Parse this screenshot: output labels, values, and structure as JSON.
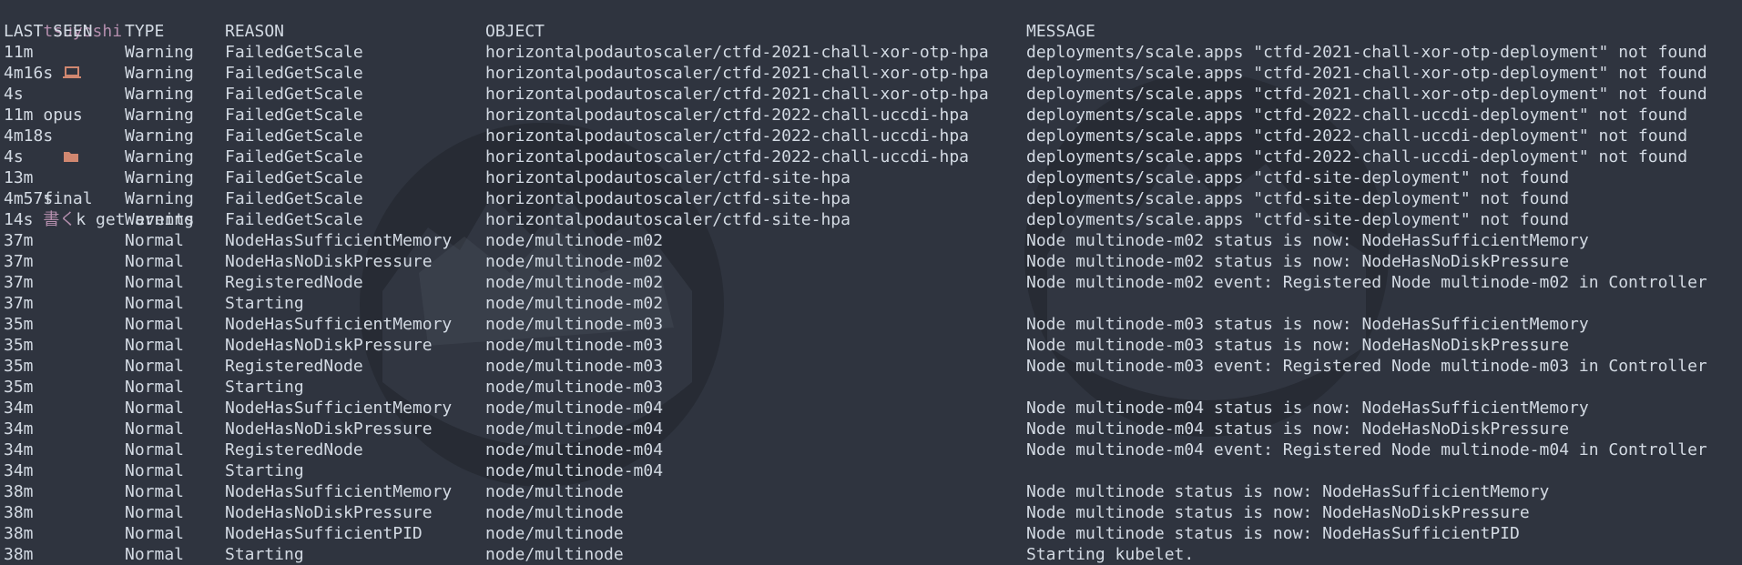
{
  "prompt": {
    "user": "tsuyoshi",
    "host_icon": "laptop-icon",
    "host": "opus",
    "folder_icon": "folder-icon",
    "dir": "final",
    "glyph": "書く",
    "command": "k get events"
  },
  "headers": {
    "last_seen": "LAST SEEN",
    "type": "TYPE",
    "reason": "REASON",
    "object": "OBJECT",
    "message": "MESSAGE"
  },
  "rows": [
    {
      "last_seen": "11m",
      "type": "Warning",
      "reason": "FailedGetScale",
      "object": "horizontalpodautoscaler/ctfd-2021-chall-xor-otp-hpa",
      "message": "deployments/scale.apps \"ctfd-2021-chall-xor-otp-deployment\" not found"
    },
    {
      "last_seen": "4m16s",
      "type": "Warning",
      "reason": "FailedGetScale",
      "object": "horizontalpodautoscaler/ctfd-2021-chall-xor-otp-hpa",
      "message": "deployments/scale.apps \"ctfd-2021-chall-xor-otp-deployment\" not found"
    },
    {
      "last_seen": "4s",
      "type": "Warning",
      "reason": "FailedGetScale",
      "object": "horizontalpodautoscaler/ctfd-2021-chall-xor-otp-hpa",
      "message": "deployments/scale.apps \"ctfd-2021-chall-xor-otp-deployment\" not found"
    },
    {
      "last_seen": "11m",
      "type": "Warning",
      "reason": "FailedGetScale",
      "object": "horizontalpodautoscaler/ctfd-2022-chall-uccdi-hpa",
      "message": "deployments/scale.apps \"ctfd-2022-chall-uccdi-deployment\" not found"
    },
    {
      "last_seen": "4m18s",
      "type": "Warning",
      "reason": "FailedGetScale",
      "object": "horizontalpodautoscaler/ctfd-2022-chall-uccdi-hpa",
      "message": "deployments/scale.apps \"ctfd-2022-chall-uccdi-deployment\" not found"
    },
    {
      "last_seen": "4s",
      "type": "Warning",
      "reason": "FailedGetScale",
      "object": "horizontalpodautoscaler/ctfd-2022-chall-uccdi-hpa",
      "message": "deployments/scale.apps \"ctfd-2022-chall-uccdi-deployment\" not found"
    },
    {
      "last_seen": "13m",
      "type": "Warning",
      "reason": "FailedGetScale",
      "object": "horizontalpodautoscaler/ctfd-site-hpa",
      "message": "deployments/scale.apps \"ctfd-site-deployment\" not found"
    },
    {
      "last_seen": "4m57s",
      "type": "Warning",
      "reason": "FailedGetScale",
      "object": "horizontalpodautoscaler/ctfd-site-hpa",
      "message": "deployments/scale.apps \"ctfd-site-deployment\" not found"
    },
    {
      "last_seen": "14s",
      "type": "Warning",
      "reason": "FailedGetScale",
      "object": "horizontalpodautoscaler/ctfd-site-hpa",
      "message": "deployments/scale.apps \"ctfd-site-deployment\" not found"
    },
    {
      "last_seen": "37m",
      "type": "Normal",
      "reason": "NodeHasSufficientMemory",
      "object": "node/multinode-m02",
      "message": "Node multinode-m02 status is now: NodeHasSufficientMemory"
    },
    {
      "last_seen": "37m",
      "type": "Normal",
      "reason": "NodeHasNoDiskPressure",
      "object": "node/multinode-m02",
      "message": "Node multinode-m02 status is now: NodeHasNoDiskPressure"
    },
    {
      "last_seen": "37m",
      "type": "Normal",
      "reason": "RegisteredNode",
      "object": "node/multinode-m02",
      "message": "Node multinode-m02 event: Registered Node multinode-m02 in Controller"
    },
    {
      "last_seen": "37m",
      "type": "Normal",
      "reason": "Starting",
      "object": "node/multinode-m02",
      "message": ""
    },
    {
      "last_seen": "35m",
      "type": "Normal",
      "reason": "NodeHasSufficientMemory",
      "object": "node/multinode-m03",
      "message": "Node multinode-m03 status is now: NodeHasSufficientMemory"
    },
    {
      "last_seen": "35m",
      "type": "Normal",
      "reason": "NodeHasNoDiskPressure",
      "object": "node/multinode-m03",
      "message": "Node multinode-m03 status is now: NodeHasNoDiskPressure"
    },
    {
      "last_seen": "35m",
      "type": "Normal",
      "reason": "RegisteredNode",
      "object": "node/multinode-m03",
      "message": "Node multinode-m03 event: Registered Node multinode-m03 in Controller"
    },
    {
      "last_seen": "35m",
      "type": "Normal",
      "reason": "Starting",
      "object": "node/multinode-m03",
      "message": ""
    },
    {
      "last_seen": "34m",
      "type": "Normal",
      "reason": "NodeHasSufficientMemory",
      "object": "node/multinode-m04",
      "message": "Node multinode-m04 status is now: NodeHasSufficientMemory"
    },
    {
      "last_seen": "34m",
      "type": "Normal",
      "reason": "NodeHasNoDiskPressure",
      "object": "node/multinode-m04",
      "message": "Node multinode-m04 status is now: NodeHasNoDiskPressure"
    },
    {
      "last_seen": "34m",
      "type": "Normal",
      "reason": "RegisteredNode",
      "object": "node/multinode-m04",
      "message": "Node multinode-m04 event: Registered Node multinode-m04 in Controller"
    },
    {
      "last_seen": "34m",
      "type": "Normal",
      "reason": "Starting",
      "object": "node/multinode-m04",
      "message": ""
    },
    {
      "last_seen": "38m",
      "type": "Normal",
      "reason": "NodeHasSufficientMemory",
      "object": "node/multinode",
      "message": "Node multinode status is now: NodeHasSufficientMemory"
    },
    {
      "last_seen": "38m",
      "type": "Normal",
      "reason": "NodeHasNoDiskPressure",
      "object": "node/multinode",
      "message": "Node multinode status is now: NodeHasNoDiskPressure"
    },
    {
      "last_seen": "38m",
      "type": "Normal",
      "reason": "NodeHasSufficientPID",
      "object": "node/multinode",
      "message": "Node multinode status is now: NodeHasSufficientPID"
    },
    {
      "last_seen": "38m",
      "type": "Normal",
      "reason": "Starting",
      "object": "node/multinode",
      "message": "Starting kubelet."
    }
  ],
  "colors": {
    "background": "#2f343f",
    "foreground": "#d3dae3",
    "user": "#b48ead",
    "icon_accent": "#d08770"
  }
}
